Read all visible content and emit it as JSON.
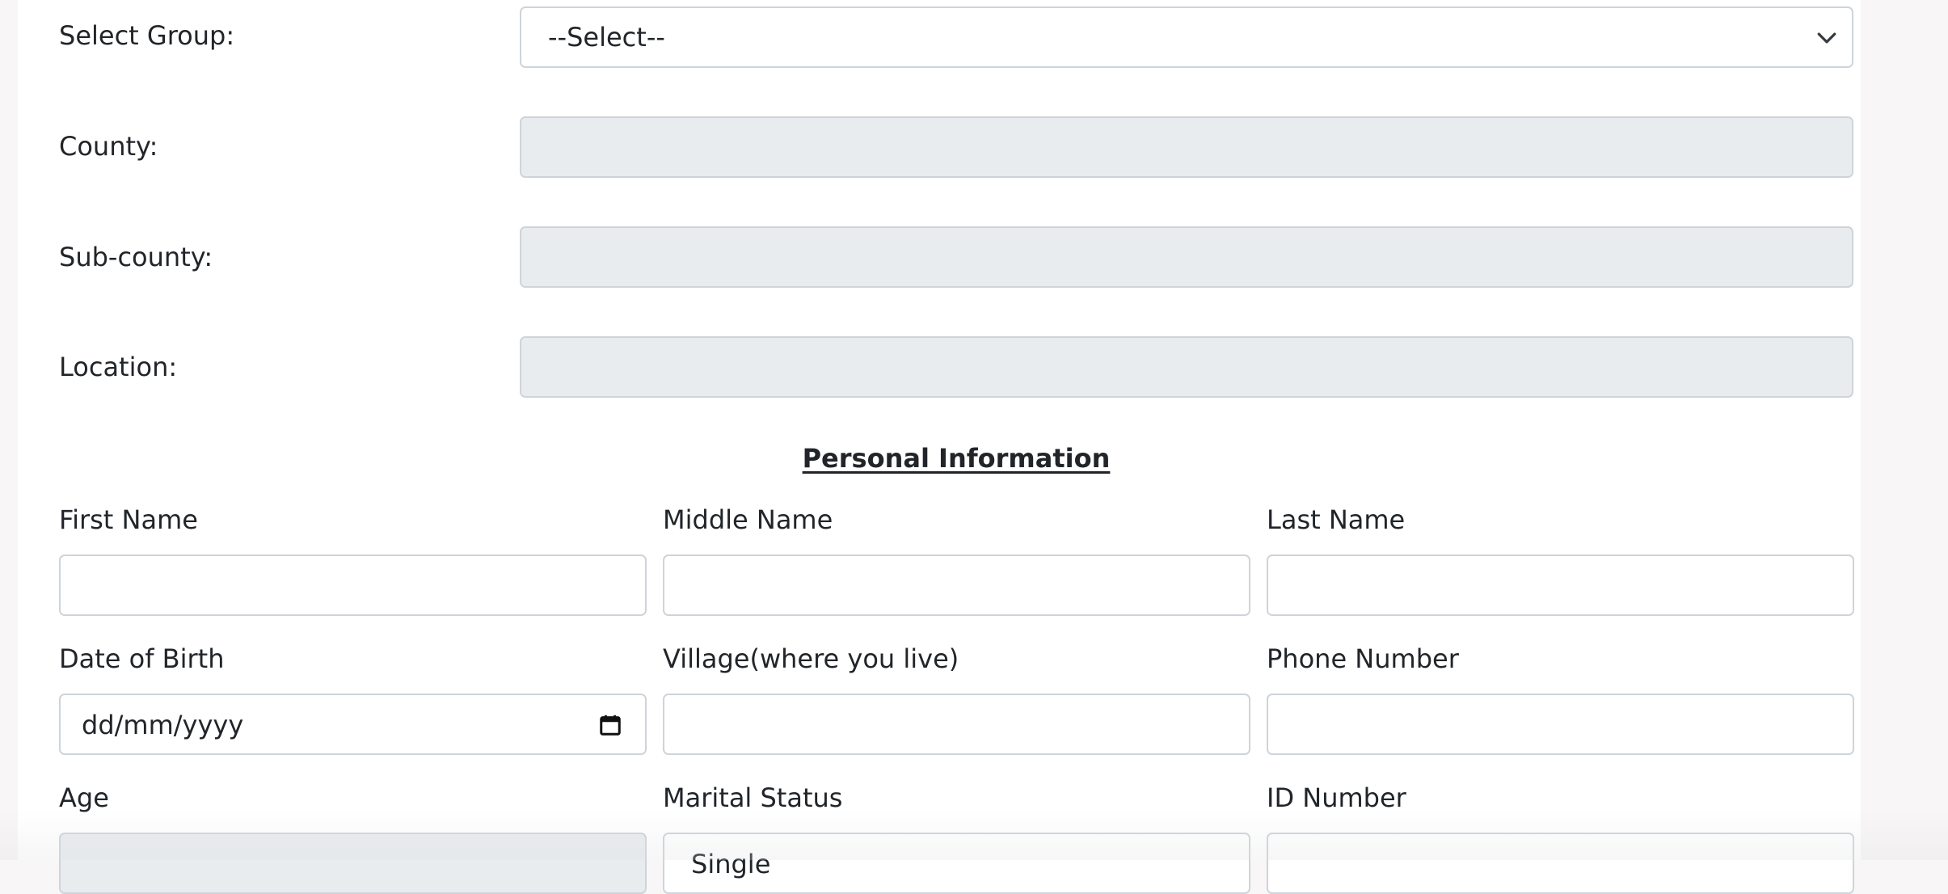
{
  "location_section": {
    "group_label": "Select Group:",
    "group_selected": "--Select--",
    "county_label": "County:",
    "subcounty_label": "Sub-county:",
    "location_label": "Location:"
  },
  "personal": {
    "title": "Personal Information",
    "first_name_label": "First Name",
    "middle_name_label": "Middle Name",
    "last_name_label": "Last Name",
    "dob_label": "Date of Birth",
    "dob_placeholder": "dd/mm/yyyy",
    "village_label": "Village(where you live)",
    "phone_label": "Phone Number",
    "age_label": "Age",
    "marital_label": "Marital Status",
    "marital_selected": "Single",
    "id_label": "ID Number"
  },
  "icons": {
    "select_chevron": "chevron-down-icon",
    "date_picker": "calendar-icon"
  }
}
